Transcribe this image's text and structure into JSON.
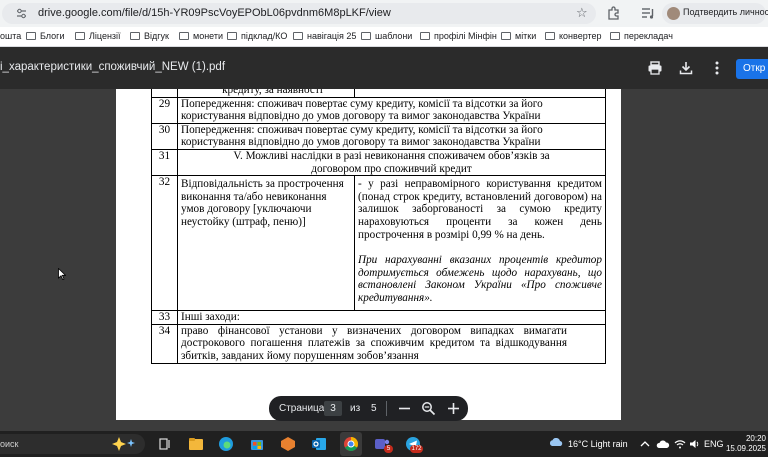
{
  "browser": {
    "url": "drive.google.com/file/d/15h-YR09PscVoyEPObL06pvdnm6M8pLKF/view",
    "profile_label": "Подтвердить личность",
    "bookmarks": [
      "ошта",
      "Блоги",
      "Ліцензії",
      "Відгук",
      "монети",
      "підклад/КО",
      "навігація 25",
      "шаблони",
      "профілі Мінфін",
      "мітки",
      "конвертер",
      "перекладач"
    ]
  },
  "viewer": {
    "file_title": "і_характеристики_споживчий_NEW (1).pdf",
    "open_button": "Откр"
  },
  "document": {
    "top_fragment": "кредиту, за наявності",
    "rows": [
      {
        "num": "29",
        "text": "Попередження: споживач повертає суму кредиту, комісії та відсотки за його користування відповідно до умов договору та вимог законодавства України"
      },
      {
        "num": "30",
        "text": "Попередження: споживач повертає суму кредиту, комісії та відсотки за його користування відповідно до умов договору та вимог законодавства України"
      },
      {
        "num": "31",
        "text": "V. Можливі наслідки в разі невиконання споживачем обов’язків за договором про споживчий кредит"
      },
      {
        "num": "32",
        "left": "Відповідальність за прострочення виконання та/або невиконання умов договору [уключаючи неустойку (штраф, пеню)]",
        "right": "- у разі неправомірного користування кредитом (понад строк кредиту, встановлений договором) на залишок заборгованості за сумою кредиту нараховуються проценти за кожен день прострочення в розмірі 0,99 % на день.",
        "right_italic": "При нарахуванні вказаних процентів кредитор дотримується обмежень щодо нарахувань, що встановлені Законом України «Про споживче кредитування»."
      },
      {
        "num": "33",
        "text": "Інші заходи:"
      },
      {
        "num": "34",
        "text": "право фінансової установи у визначених договором випадках вимагати дострокового погашення платежів за споживчим кредитом та відшкодування збитків, завданих йому порушенням зобов’язання"
      }
    ]
  },
  "pager": {
    "label": "Страница",
    "current": "3",
    "of": "из",
    "total": "5"
  },
  "taskbar": {
    "search": "оиск",
    "weather": "16°C  Light rain",
    "lang": "ENG",
    "time": "20:20",
    "date": "15.09.2025",
    "badges": {
      "teams": "5",
      "telegram": "172"
    }
  }
}
